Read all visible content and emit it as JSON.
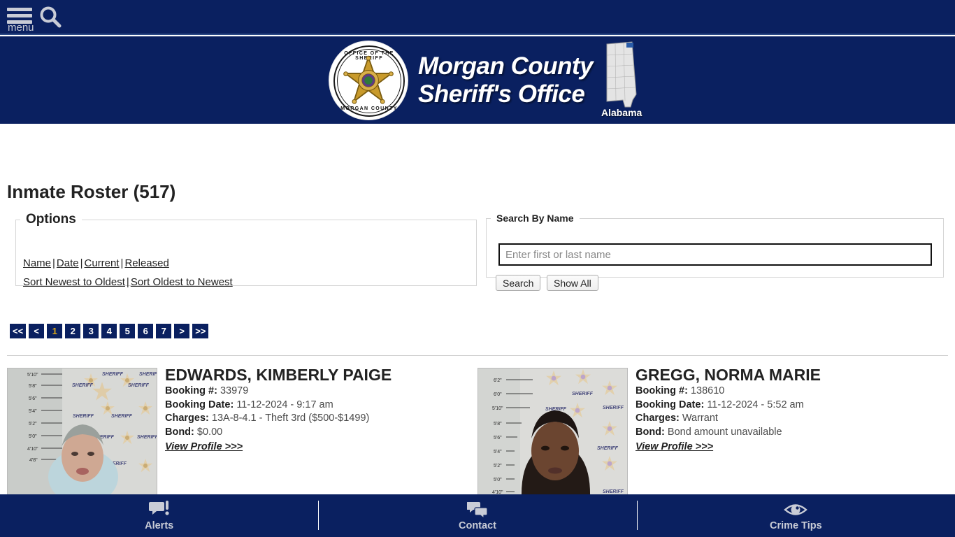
{
  "topbar": {
    "menu_label": "menu",
    "menu_icon": "hamburger-menu-icon",
    "search_icon": "search-icon"
  },
  "header": {
    "seal_text_top": "OFFICE OF THE SHERIFF",
    "seal_text_bottom": "MORGAN COUNTY",
    "seal_star_text": "SHERIFF",
    "title_line1": "Morgan County",
    "title_line2": "Sheriff's Office",
    "state_label": "Alabama",
    "navy": "#0A2060",
    "gold": "#D8A51A"
  },
  "main": {
    "page_title": "Inmate Roster (517)",
    "options": {
      "legend": "Options",
      "links_row1": [
        "Name",
        "Date",
        "Current",
        "Released"
      ],
      "links_row2": [
        "Sort Newest to Oldest",
        "Sort Oldest to Newest"
      ],
      "separator": "|"
    },
    "search": {
      "legend": "Search By Name",
      "placeholder": "Enter first or last name",
      "value": "",
      "search_button": "Search",
      "showall_button": "Show All"
    },
    "pagination": {
      "first": "<<",
      "prev": "<",
      "pages": [
        "1",
        "2",
        "3",
        "4",
        "5",
        "6",
        "7"
      ],
      "next": ">",
      "last": ">>",
      "active": "1"
    },
    "labels": {
      "booking_number": "Booking #:",
      "booking_date": "Booking Date:",
      "charges": "Charges:",
      "bond": "Bond:",
      "view_profile": "View Profile >>>"
    },
    "inmates": [
      {
        "name": "EDWARDS, KIMBERLY PAIGE",
        "booking_number": "33979",
        "booking_date": "11-12-2024 - 9:17 am",
        "charges": "13A-8-4.1 - Theft 3rd ($500-$1499)",
        "bond": "$0.00",
        "mugshot_alt": "mugshot-edwards-kimberly-paige"
      },
      {
        "name": "GREGG, NORMA MARIE",
        "booking_number": "138610",
        "booking_date": "11-12-2024 - 5:52 am",
        "charges": "Warrant",
        "bond": "Bond amount unavailable",
        "mugshot_alt": "mugshot-gregg-norma-marie"
      }
    ]
  },
  "bottomnav": {
    "items": [
      {
        "label": "Alerts",
        "icon": "alert-speech-bubble-icon"
      },
      {
        "label": "Contact",
        "icon": "chat-bubbles-icon"
      },
      {
        "label": "Crime Tips",
        "icon": "eye-icon"
      }
    ]
  }
}
